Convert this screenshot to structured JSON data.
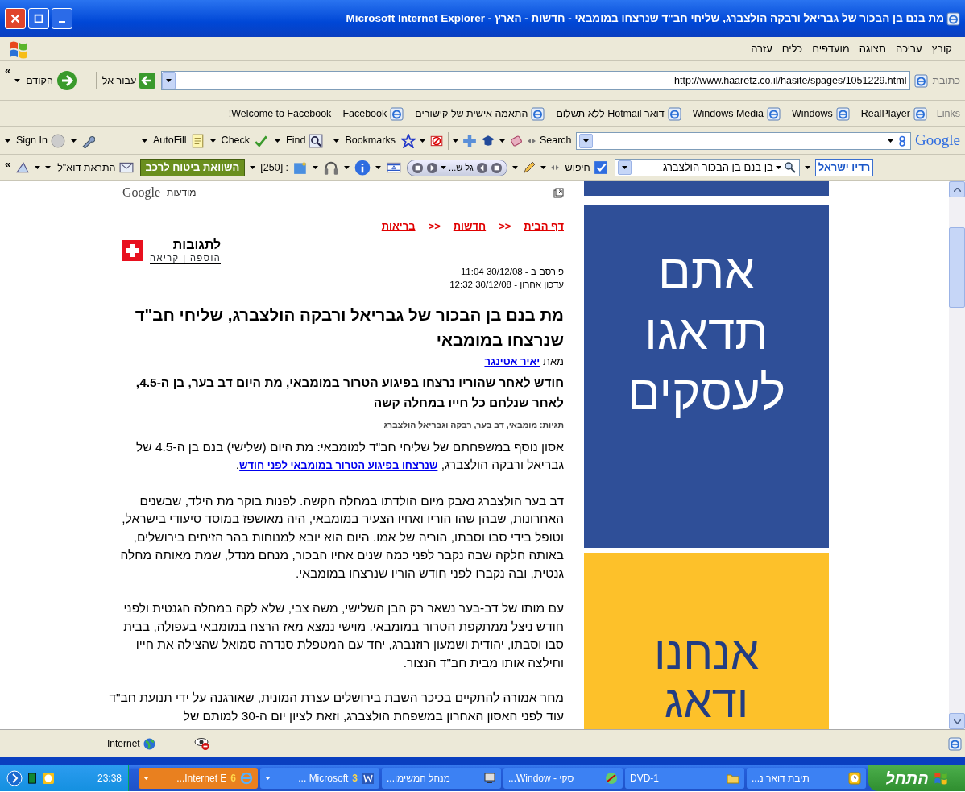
{
  "window": {
    "title": "מת בנם בן הבכור של גבריאל ורבקה הולצברג, שליחי חב\"ד שנרצחו במומבאי - חדשות - הארץ - Microsoft Internet Explorer"
  },
  "menu": [
    "קובץ",
    "עריכה",
    "תצוגה",
    "מועדפים",
    "כלים",
    "עזרה"
  ],
  "address_bar": {
    "chevron": "«",
    "back": "הקודם",
    "go": "עבור אל",
    "label": "כתובת",
    "url": "http://www.haaretz.co.il/hasite/spages/1051229.html"
  },
  "links_bar": {
    "label": "Links",
    "links": [
      {
        "label": "RealPlayer",
        "kind": "page"
      },
      {
        "label": "Windows",
        "kind": "page"
      },
      {
        "label": "Windows Media",
        "kind": "page"
      },
      {
        "label": "דואר Hotmail ללא תשלום",
        "kind": "page"
      },
      {
        "label": "התאמה אישית של קישורים",
        "kind": "page"
      },
      {
        "label": "Facebook",
        "kind": "page"
      },
      {
        "label": "Welcome to Facebook!",
        "kind": "plain"
      }
    ]
  },
  "google_toolbar": {
    "sign_in": "Sign In",
    "autofill": "AutoFill",
    "check": "Check",
    "find": "Find",
    "bookmarks": "Bookmarks",
    "search_label": "Search",
    "logo": "Google"
  },
  "israel_toolbar": {
    "chevron": "«",
    "mail_alert": "התראת דוא\"ל",
    "insurance": "השוואת ביטוח לרכב",
    "count": "[250] :",
    "station": "גל ש...",
    "search": "חיפוש",
    "query": "בן בנם בן הבכור הולצברג",
    "brand": "רדיו ישראל"
  },
  "ads_header": {
    "label": "מודעות",
    "logo": "Google"
  },
  "breadcrumbs": [
    {
      "label": "דף הבית",
      "kind": "link"
    },
    {
      "label": ">>",
      "kind": "separator"
    },
    {
      "label": "חדשות",
      "kind": "link"
    },
    {
      "label": ">>",
      "kind": "separator"
    },
    {
      "label": "בריאות",
      "kind": "link"
    }
  ],
  "talkback": {
    "title": "לתגובות",
    "add": "הוספה",
    "divider": "|",
    "read": "קריאה"
  },
  "dates": [
    "פורסם ב - 30/12/08 11:04",
    "עדכון אחרון - 30/12/08 12:32"
  ],
  "headline": "מת בנם בן הבכור של גבריאל ורבקה הולצברג, שליחי חב\"ד שנרצחו במומבאי",
  "byline": {
    "prefix": "מאת",
    "author": "יאיר אטינגר"
  },
  "subtitle": "חודש לאחר שהוריו נרצחו בפיגוע הטרור במומבאי, מת היום דב בער, בן ה-4.5, לאחר שנלחם כל חייו במחלה קשה",
  "tags": "תגיות: מומבאי, דב בער, רבקה וגבריאל הולצברג",
  "paragraphs": [
    {
      "text": "אסון נוסף במשפחתם של שליחי חב\"ד למומבאי: מת היום (שלישי) בנם בן ה-4.5 של גבריאל ורבקה הולצברג, ",
      "link": "שנרצחו בפיגוע הטרור במומבאי לפני חודש",
      "after": "."
    },
    {
      "text": "דב בער הולצברג נאבק מיום הולדתו במחלה הקשה. לפנות בוקר מת הילד, שבשנים האחרונות, שבהן שהו הוריו ואחיו הצעיר במומבאי, היה מאושפז במוסד סיעודי בישראל, וטופל בידי סבו וסבתו, הוריה של אמו. היום הוא יובא למנוחות בהר הזיתים בירושלים, באותה חלקה שבה נקבר לפני כמה שנים אחיו הבכור, מנחם מנדל, שמת מאותה מחלה גנטית, ובה נקברו לפני חודש הוריו שנרצחו במומבאי."
    },
    {
      "text": "עם מותו של דב-בער נשאר רק הבן השלישי, משה צבי, שלא לקה במחלה הגנטית ולפני חודש ניצל ממתקפת הטרור במומבאי. מוישי נמצא מאז הרצח במומבאי בעפולה, בבית סבו וסבתו, יהודית ושמעון רוזנברג, יחד עם המטפלת סנדרה סמואל שהצילה את חייו וחילצה אותו מבית חב\"ד הנצור."
    },
    {
      "text": "מחר אמורה להתקיים בכיכר השבת בירושלים עצרת המונית, שאורגנה על ידי תנועת חב\"ד עוד לפני האסון האחרון במשפחת הולצברג, וזאת לציון יום ה-30 למותם של"
    }
  ],
  "ads": [
    {
      "kind": "blue",
      "lines": [
        "אתם",
        "תדאגו",
        "לעסקים"
      ]
    },
    {
      "kind": "yellow",
      "lines": [
        "אנחנו",
        "ודאג"
      ]
    }
  ],
  "status_bar": {
    "zone": "Internet"
  },
  "taskbar": {
    "start": "התחל",
    "clock": "23:38",
    "tasks": [
      {
        "label": "תיבת דואר נ...",
        "kind": "clock",
        "selected": false
      },
      {
        "label": "DVD-1",
        "kind": "folder",
        "selected": false
      },
      {
        "label": "סקי - Window...",
        "kind": "app",
        "selected": false
      },
      {
        "label": "מנהל המשימו...",
        "kind": "monitor",
        "selected": false
      },
      {
        "label": "Microsoft ...",
        "count": "3",
        "kind": "word",
        "selected": false
      },
      {
        "label": "Internet E...",
        "count": "6",
        "kind": "browser",
        "selected": true
      }
    ]
  }
}
